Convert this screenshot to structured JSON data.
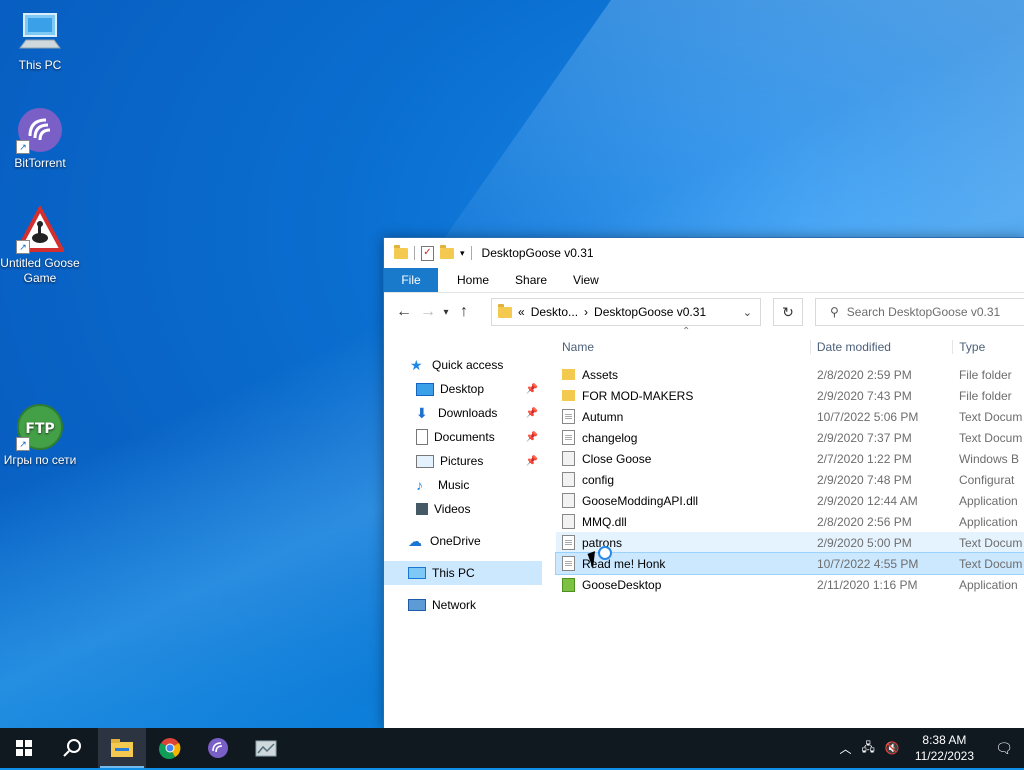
{
  "desktop": {
    "icons": [
      {
        "label": "This PC"
      },
      {
        "label": "BitTorrent"
      },
      {
        "label": "Untitled Goose Game"
      },
      {
        "label": "Игры по сети"
      }
    ],
    "ftp_text": "FTP"
  },
  "window": {
    "title": "DesktopGoose v0.31",
    "ribbon_tabs": [
      "File",
      "Home",
      "Share",
      "View"
    ],
    "address": {
      "prefix": "«",
      "crumb1": "Deskto...",
      "sep": "›",
      "crumb2": "DesktopGoose v0.31"
    },
    "search_placeholder": "Search DesktopGoose v0.31",
    "nav": {
      "quick_access": "Quick access",
      "items": [
        "Desktop",
        "Downloads",
        "Documents",
        "Pictures",
        "Music",
        "Videos"
      ],
      "onedrive": "OneDrive",
      "this_pc": "This PC",
      "network": "Network"
    },
    "columns": {
      "name": "Name",
      "date": "Date modified",
      "type": "Type"
    },
    "files": [
      {
        "name": "Assets",
        "date": "2/8/2020 2:59 PM",
        "type": "File folder"
      },
      {
        "name": "FOR MOD-MAKERS",
        "date": "2/9/2020 7:43 PM",
        "type": "File folder"
      },
      {
        "name": "Autumn",
        "date": "10/7/2022 5:06 PM",
        "type": "Text Docum"
      },
      {
        "name": "changelog",
        "date": "2/9/2020 7:37 PM",
        "type": "Text Docum"
      },
      {
        "name": "Close Goose",
        "date": "2/7/2020 1:22 PM",
        "type": "Windows B"
      },
      {
        "name": "config",
        "date": "2/9/2020 7:48 PM",
        "type": "Configurat"
      },
      {
        "name": "GooseModdingAPI.dll",
        "date": "2/9/2020 12:44 AM",
        "type": "Application"
      },
      {
        "name": "MMQ.dll",
        "date": "2/8/2020 2:56 PM",
        "type": "Application"
      },
      {
        "name": "patrons",
        "date": "2/9/2020 5:00 PM",
        "type": "Text Docum"
      },
      {
        "name": "Read me! Honk",
        "date": "10/7/2022 4:55 PM",
        "type": "Text Docum"
      },
      {
        "name": "GooseDesktop",
        "date": "2/11/2020 1:16 PM",
        "type": "Application"
      }
    ]
  },
  "taskbar": {
    "time": "8:38 AM",
    "date": "11/22/2023"
  }
}
